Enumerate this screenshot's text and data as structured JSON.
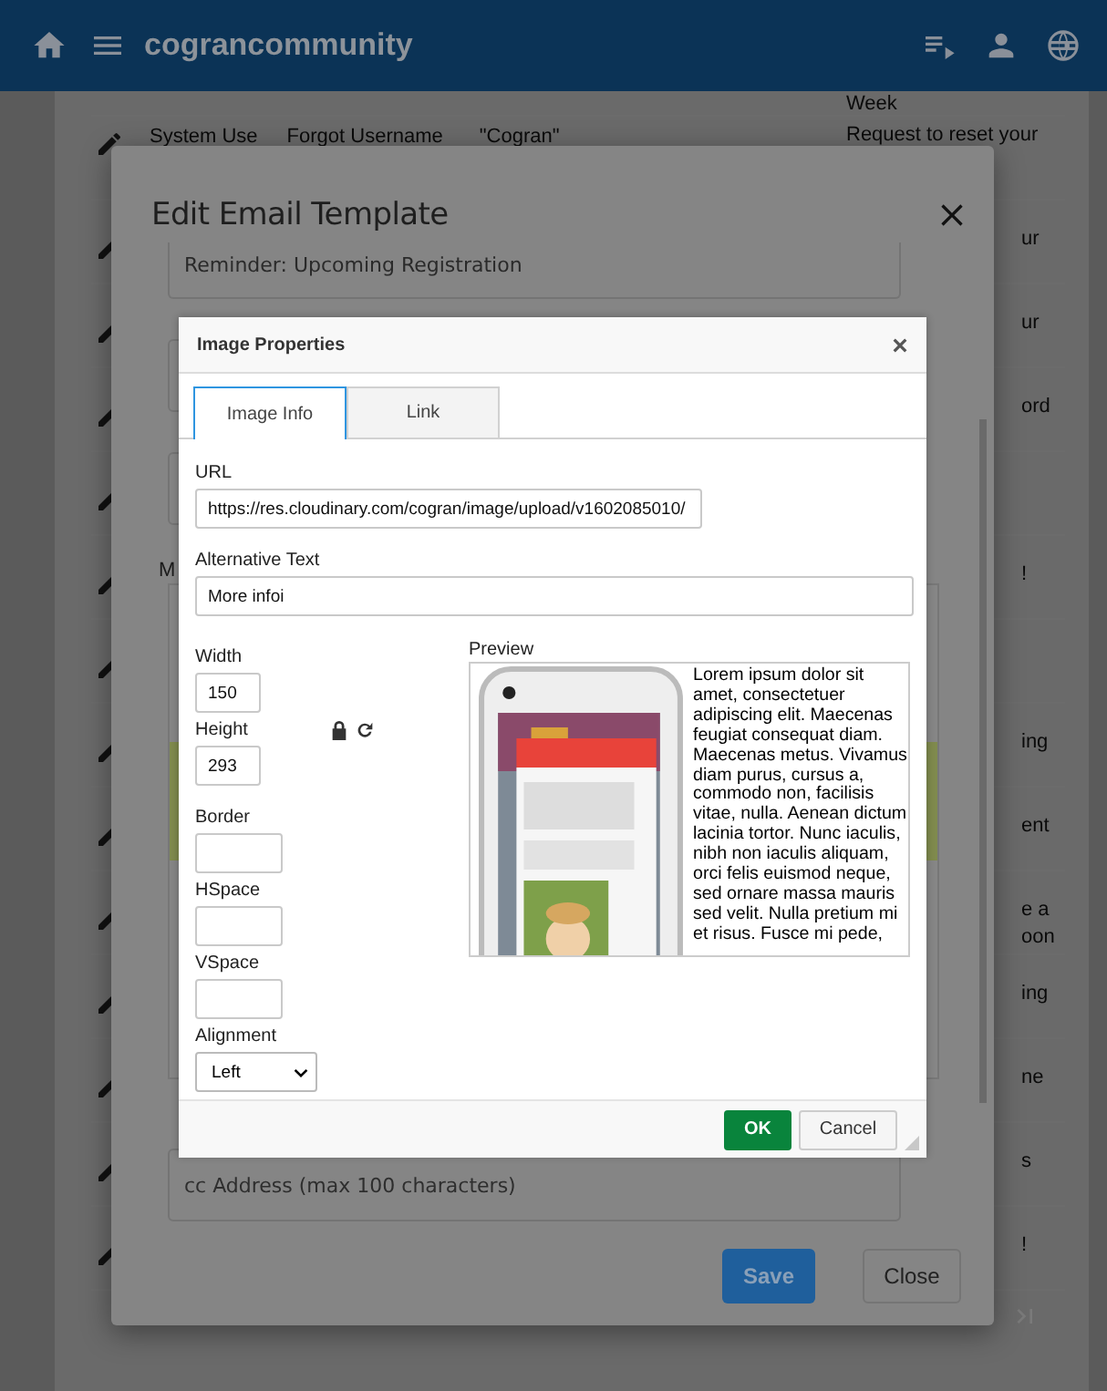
{
  "app_bar": {
    "title": "cograncommunity"
  },
  "background_table": {
    "rows": [
      {
        "cells": [],
        "description": [
          "Week"
        ]
      },
      {
        "cells": [
          "System Use",
          "Forgot Username",
          "\"Cogran\""
        ],
        "description": [
          "Request to reset your"
        ]
      },
      {
        "cells": [],
        "description": [
          "ur"
        ]
      },
      {
        "cells": [],
        "description": [
          "ur"
        ]
      },
      {
        "cells": [],
        "description": [
          "ord"
        ]
      },
      {
        "cells": [],
        "description": []
      },
      {
        "cells": [],
        "description": [
          "!"
        ]
      },
      {
        "cells": [],
        "description": []
      },
      {
        "cells": [],
        "description": [
          "ing"
        ]
      },
      {
        "cells": [],
        "description": [
          "ent"
        ]
      },
      {
        "cells": [],
        "description": [
          "e a",
          "oon"
        ]
      },
      {
        "cells": [],
        "description": [
          "ing"
        ]
      },
      {
        "cells": [],
        "description": [
          "ne"
        ]
      },
      {
        "cells": [],
        "description": [
          "s"
        ]
      },
      {
        "cells": [],
        "description": [
          "!"
        ]
      }
    ]
  },
  "edit_dialog": {
    "title": "Edit Email Template",
    "subject_value": "Reminder: Upcoming Registration",
    "message_label": "M",
    "cc_placeholder": "cc Address (max 100 characters)",
    "buttons": [
      "Save",
      "Close"
    ]
  },
  "image_properties": {
    "title": "Image Properties",
    "tabs": [
      {
        "label": "Image Info",
        "selected": true
      },
      {
        "label": "Link",
        "selected": false
      }
    ],
    "url": {
      "label": "URL",
      "value": "https://res.cloudinary.com/cogran/image/upload/v1602085010/"
    },
    "alt": {
      "label": "Alternative Text",
      "value": "More infoi"
    },
    "fields": [
      {
        "label": "Width",
        "value": "150",
        "kind": "small"
      },
      {
        "label": "Height",
        "value": "293",
        "kind": "small"
      },
      {
        "label": "Border",
        "kind": "wide"
      },
      {
        "label": "HSpace",
        "kind": "wide"
      },
      {
        "label": "VSpace",
        "kind": "wide"
      }
    ],
    "alignment": {
      "label": "Alignment",
      "value": "Left"
    },
    "preview": {
      "label": "Preview",
      "text": "Lorem ipsum dolor sit amet, consectetuer adipiscing elit. Maecenas feugiat consequat diam. Maecenas metus. Vivamus diam purus, cursus a, commodo non, facilisis vitae, nulla. Aenean dictum lacinia tortor. Nunc iaculis, nibh non iaculis aliquam, orci felis euismod neque, sed ornare massa mauris sed velit. Nulla pretium mi et risus. Fusce mi pede,"
    },
    "buttons": [
      "OK",
      "Cancel"
    ]
  }
}
